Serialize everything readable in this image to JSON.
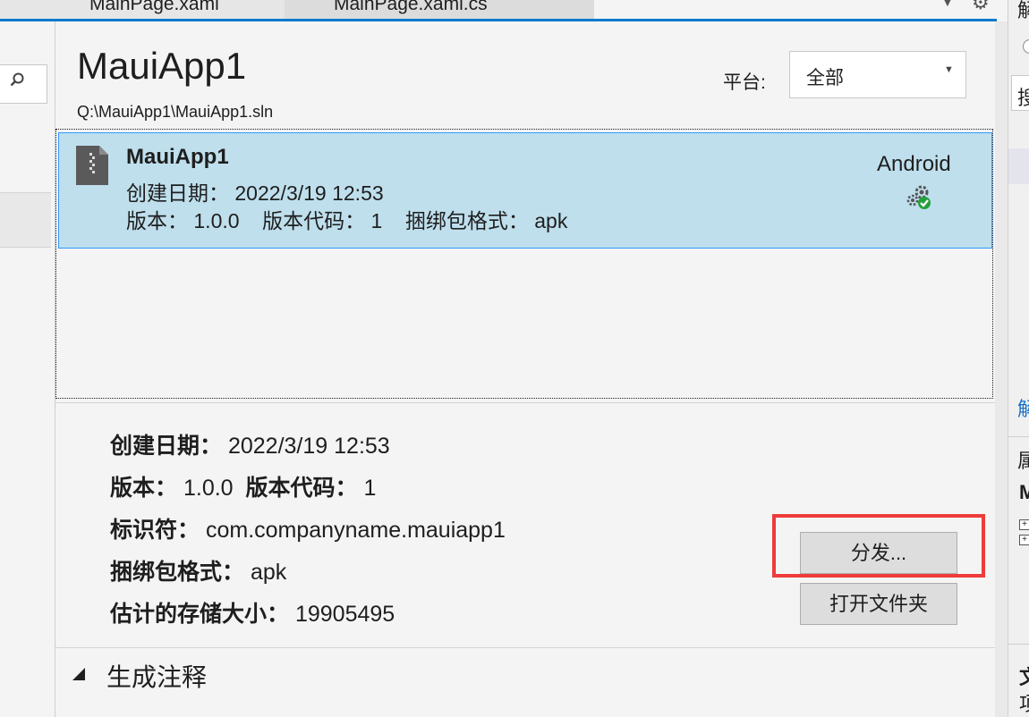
{
  "tabs": [
    {
      "label": "MainPage.xaml"
    },
    {
      "label": "MainPage.xaml.cs"
    }
  ],
  "app": {
    "title": "MauiApp1",
    "solution_path": "Q:\\MauiApp1\\MauiApp1.sln"
  },
  "platform": {
    "label": "平台:",
    "selected": "全部"
  },
  "archive_item": {
    "name": "MauiApp1",
    "created": "创建日期： 2022/3/19 12:53",
    "version_line": "版本： 1.0.0    版本代码： 1    捆绑包格式： apk",
    "platform": "Android"
  },
  "details": {
    "created_label": "创建日期：",
    "created_value": "2022/3/19 12:53",
    "version_label": "版本：",
    "version_value": "1.0.0",
    "version_code_label": "版本代码：",
    "version_code_value": "1",
    "identifier_label": "标识符：",
    "identifier_value": "com.companyname.mauiapp1",
    "format_label": "捆绑包格式：",
    "format_value": "apk",
    "size_label": "估计的存储大小：",
    "size_value": "19905495"
  },
  "buttons": {
    "distribute": "分发...",
    "open_folder": "打开文件夹"
  },
  "notes": {
    "label": "生成注释"
  },
  "right_panel": {
    "top_char": "解",
    "search_char": "搜",
    "link_char": "解",
    "prop_char": "属",
    "m_char": "M",
    "wen_char": "文",
    "xiang_char": "项"
  },
  "colors": {
    "accent": "#007acc",
    "selection": "#bfdfed",
    "highlight": "#ef3b3b"
  },
  "icons": {
    "search": "search-icon",
    "archive": "zip-file-icon",
    "status": "gear-checkmark-icon",
    "dropdown": "chevron-down-icon",
    "collapse": "triangle-collapse-icon"
  }
}
